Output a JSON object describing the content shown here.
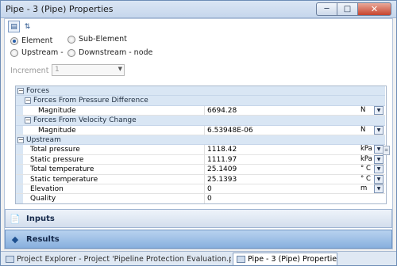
{
  "window": {
    "title": "Pipe - 3 (Pipe) Properties"
  },
  "toolbar": {
    "categorized_icon": "categorized-view-icon",
    "sort_icon": "sort-az-icon"
  },
  "radios": {
    "element": "Element",
    "sub_element": "Sub-Element",
    "upstream": "Upstream -",
    "downstream": "Downstream - node"
  },
  "increment": {
    "label": "Increment",
    "value": "1"
  },
  "grid": {
    "forces": "Forces",
    "pressure_diff": "Forces From Pressure Difference",
    "pd_magnitude_label": "Magnitude",
    "pd_magnitude_value": "6694.28",
    "pd_magnitude_unit": "N",
    "velocity_change": "Forces From Velocity Change",
    "vc_magnitude_label": "Magnitude",
    "vc_magnitude_value": "6.53948E-06",
    "vc_magnitude_unit": "N",
    "upstream": "Upstream",
    "rows": [
      {
        "label": "Total pressure",
        "value": "1118.42",
        "unit": "kPa"
      },
      {
        "label": "Static pressure",
        "value": "1111.97",
        "unit": "kPa"
      },
      {
        "label": "Total temperature",
        "value": "25.1409",
        "unit": "° C"
      },
      {
        "label": "Static temperature",
        "value": "25.1393",
        "unit": "° C"
      },
      {
        "label": "Elevation",
        "value": "0",
        "unit": "m"
      },
      {
        "label": "Quality",
        "value": "0",
        "unit": ""
      }
    ]
  },
  "panels": {
    "inputs": "Inputs",
    "results": "Results"
  },
  "taskbar": {
    "tab1": "Project Explorer - Project 'Pipeline Protection Evaluation.proj'",
    "tab2": "Pipe - 3 (Pipe) Properties"
  }
}
